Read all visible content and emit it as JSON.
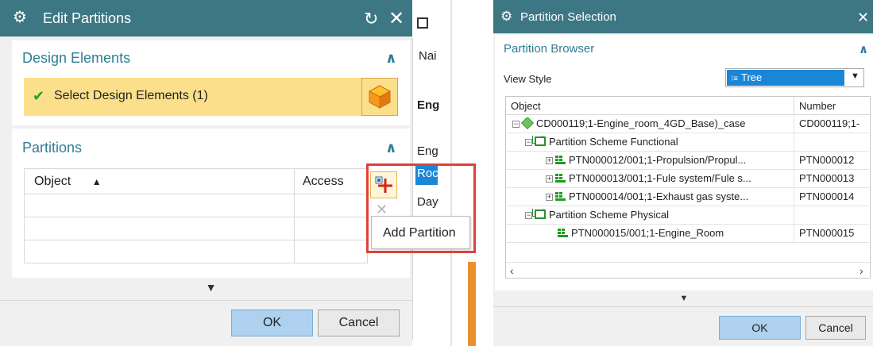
{
  "edit_dialog": {
    "title": "Edit Partitions",
    "design_elements": {
      "title": "Design Elements",
      "select_label": "Select Design Elements (1)"
    },
    "partitions": {
      "title": "Partitions",
      "columns": [
        "Object",
        "Access"
      ],
      "tooltip": "Add Partition"
    },
    "ok_label": "OK",
    "cancel_label": "Cancel"
  },
  "background_columns": {
    "header": "Nai",
    "items": [
      "Eng",
      "Eng",
      "Roc",
      "Day"
    ]
  },
  "selection_dialog": {
    "title": "Partition Selection",
    "browser_title": "Partition Browser",
    "view_style_label": "View Style",
    "view_style_value": "Tree",
    "columns": [
      "Object",
      "Number"
    ],
    "rows": [
      {
        "level": 0,
        "expander": "−",
        "icon": "cube-icon",
        "object": "CD000119;1-Engine_room_4GD_Base)_case",
        "number": "CD000119;1-"
      },
      {
        "level": 1,
        "expander": "−",
        "icon": "partition-scheme-icon",
        "object": "Partition Scheme Functional",
        "number": ""
      },
      {
        "level": 2,
        "expander": "+",
        "icon": "partition-icon",
        "object": "PTN000012/001;1-Propulsion/Propul...",
        "number": "PTN000012"
      },
      {
        "level": 2,
        "expander": "+",
        "icon": "partition-icon",
        "object": "PTN000013/001;1-Fule system/Fule s...",
        "number": "PTN000013"
      },
      {
        "level": 2,
        "expander": "+",
        "icon": "partition-icon",
        "object": "PTN000014/001;1-Exhaust gas syste...",
        "number": "PTN000014"
      },
      {
        "level": 1,
        "expander": "−",
        "icon": "partition-scheme-icon",
        "object": "Partition Scheme Physical",
        "number": ""
      },
      {
        "level": 2,
        "expander": "",
        "icon": "partition-icon",
        "object": "PTN000015/001;1-Engine_Room",
        "number": "PTN000015"
      }
    ],
    "ok_label": "OK",
    "cancel_label": "Cancel"
  },
  "colors": {
    "titlebar": "#3d7784",
    "section_title": "#2f7e95",
    "selection_highlight": "#fcdf8a",
    "view_style_bg": "#1a86d8",
    "annotation_box": "#e0403b",
    "ok_button": "#add1ef"
  }
}
